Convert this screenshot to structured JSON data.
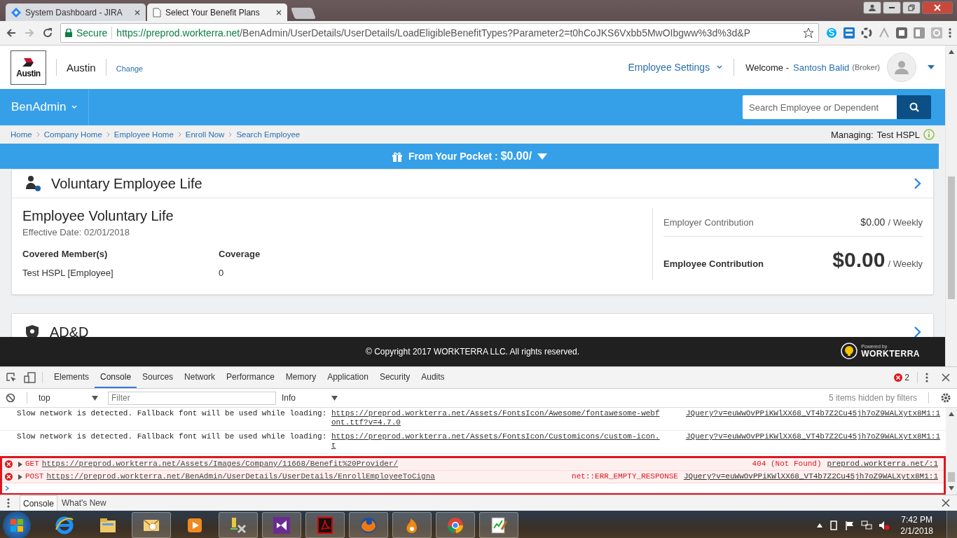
{
  "browser": {
    "tabs": [
      {
        "title": "System Dashboard - JIRA",
        "selected": false
      },
      {
        "title": "Select Your Benefit Plans",
        "selected": true
      }
    ],
    "secure_label": "Secure",
    "url_host": "https://preprod.workterra.net",
    "url_path": "/BenAdmin/UserDetails/UserDetails/LoadEligibleBenefitTypes?Parameter2=t0hCoJKS6Vxbb5MwOIbgww%3d%3d&P"
  },
  "header": {
    "logo_text": "Austin",
    "company": "Austin",
    "change_link": "Change",
    "settings_menu": "Employee Settings",
    "welcome": "Welcome -",
    "user_name": "Santosh Balid",
    "user_role": "(Broker)"
  },
  "nav": {
    "menu": "BenAdmin",
    "search_placeholder": "Search Employee or Dependent"
  },
  "breadcrumbs": [
    "Home",
    "Company Home",
    "Employee Home",
    "Enroll Now",
    "Search Employee"
  ],
  "managing": {
    "label": "Managing:",
    "value": "Test HSPL"
  },
  "pocket": {
    "label": "From Your Pocket :",
    "amount": "$0.00/"
  },
  "sections": [
    {
      "title": "Voluntary Employee Life",
      "plan": "Employee Voluntary Life",
      "effective": "Effective Date: 02/01/2018",
      "columns": [
        "Covered Member(s)",
        "Coverage"
      ],
      "values": [
        "Test HSPL [Employee]",
        "0"
      ],
      "employer_label": "Employer Contribution",
      "employer_amount": "$0.00",
      "employer_period": "/ Weekly",
      "employee_label": "Employee Contribution",
      "employee_amount": "$0.00",
      "employee_period": "/ Weekly"
    },
    {
      "title": "AD&D"
    }
  ],
  "footer": {
    "copyright": "© Copyright 2017 WORKTERRA LLC. All rights reserved.",
    "powered_by": "Powered by",
    "brand": "WORKTERRA"
  },
  "devtools": {
    "tabs": [
      {
        "label": "Elements",
        "selected": false
      },
      {
        "label": "Console",
        "selected": true
      },
      {
        "label": "Sources",
        "selected": false
      },
      {
        "label": "Network",
        "selected": false
      },
      {
        "label": "Performance",
        "selected": false
      },
      {
        "label": "Memory",
        "selected": false
      },
      {
        "label": "Application",
        "selected": false
      },
      {
        "label": "Security",
        "selected": false
      },
      {
        "label": "Audits",
        "selected": false
      }
    ],
    "error_count": "2",
    "context": "top",
    "filter_placeholder": "Filter",
    "level": "Info",
    "hidden_note": "5 items hidden by filters",
    "logs": [
      {
        "kind": "info",
        "text": "Slow network is detected. Fallback font will be used while loading:",
        "link": "https://preprod.workterra.net/Assets/FontsIcon/Awesome/fontawesome-webfont.ttf?v=4.7.0",
        "source": "JQuery?v=euWwOvPPiKWlXX68_VT4b7Z2Cu45jh7oZ9WALXytx8M1:1"
      },
      {
        "kind": "info",
        "text": "Slow network is detected. Fallback font will be used while loading:",
        "link": "https://preprod.workterra.net/Assets/FontsIcon/Customicons/custom-icon.t",
        "source": "JQuery?v=euWwOvPPiKWlXX68_VT4b7Z2Cu45jh7oZ9WALXytx8M1:1"
      },
      {
        "kind": "error",
        "method": "GET",
        "link": "https://preprod.workterra.net/Assets/Images/Company/11668/Benefit%20Provider/",
        "text": "404 (Not Found)",
        "source": "preprod.workterra.net/:1"
      },
      {
        "kind": "error",
        "method": "POST",
        "link": "https://preprod.workterra.net/BenAdmin/UserDetails/UserDetails/EnrollEmployeeToCigna",
        "text": "net::ERR_EMPTY_RESPONSE",
        "source": "JQuery?v=euWwOvPPiKWlXX68_VT4b7Z2Cu45jh7oZ9WALXytx8M1:1"
      }
    ],
    "drawer_tabs": [
      {
        "label": "Console",
        "selected": true
      },
      {
        "label": "What's New",
        "selected": false
      }
    ]
  },
  "taskbar": {
    "time": "7:42 PM",
    "date": "2/1/2018"
  }
}
